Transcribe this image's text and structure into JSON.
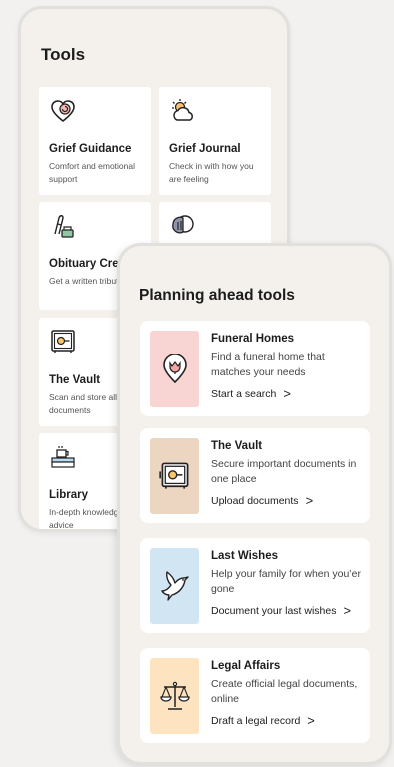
{
  "tools_screen": {
    "title": "Tools",
    "cards": [
      {
        "title": "Grief Guidance",
        "desc": "Comfort and emotional support",
        "icon": "heart-icon"
      },
      {
        "title": "Grief Journal",
        "desc": "Check in with how you are feeling",
        "icon": "sun-cloud-icon"
      },
      {
        "title": "Obituary Creator",
        "desc": "Get a written tribute",
        "icon": "quill-icon"
      },
      {
        "title": "",
        "desc": "",
        "icon": "hand-icon"
      },
      {
        "title": "The Vault",
        "desc": "Scan and store all documents",
        "icon": "safe-icon"
      },
      {
        "title": "Library",
        "desc": "In-depth knowledge and advice",
        "icon": "coffee-icon"
      }
    ]
  },
  "planning_screen": {
    "title": "Planning ahead tools",
    "cards": [
      {
        "title": "Funeral Homes",
        "desc": "Find a funeral home that matches your needs",
        "action": "Start a search",
        "color": "#f8d4d2",
        "icon": "tulip-pin-icon"
      },
      {
        "title": "The Vault",
        "desc": "Secure important documents in one place",
        "action": "Upload documents",
        "color": "#ecd5c1",
        "icon": "safe-icon"
      },
      {
        "title": "Last Wishes",
        "desc": "Help your family for when you’er gone",
        "action": "Document your last wishes",
        "color": "#d2e5f2",
        "icon": "dove-icon"
      },
      {
        "title": "Legal Affairs",
        "desc": "Create official legal documents, online",
        "action": "Draft a legal record",
        "color": "#fde3bf",
        "icon": "scales-icon"
      }
    ]
  },
  "chevron": ">"
}
